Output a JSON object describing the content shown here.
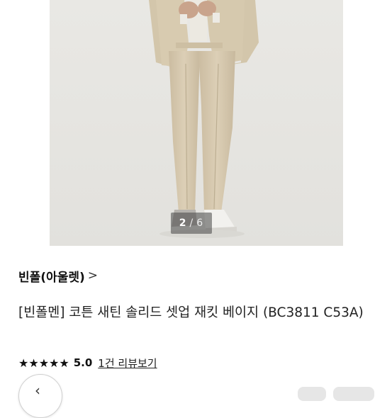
{
  "gallery": {
    "current": "2",
    "separator": "/",
    "total": "6"
  },
  "brand": {
    "name": "빈폴(아울렛)",
    "chevron": ">"
  },
  "product": {
    "title": "[빈폴멘] 코튼 새틴 솔리드 셋업 재킷 베이지 (BC3811 C53A)"
  },
  "rating": {
    "stars": "★★★★★",
    "score": "5.0",
    "review_link": "1건 리뷰보기"
  },
  "nav": {
    "back_glyph": "‹"
  },
  "colors": {
    "suit_beige": "#d6c8ae",
    "photo_bg": "#e6e5e1",
    "text": "#222222"
  }
}
